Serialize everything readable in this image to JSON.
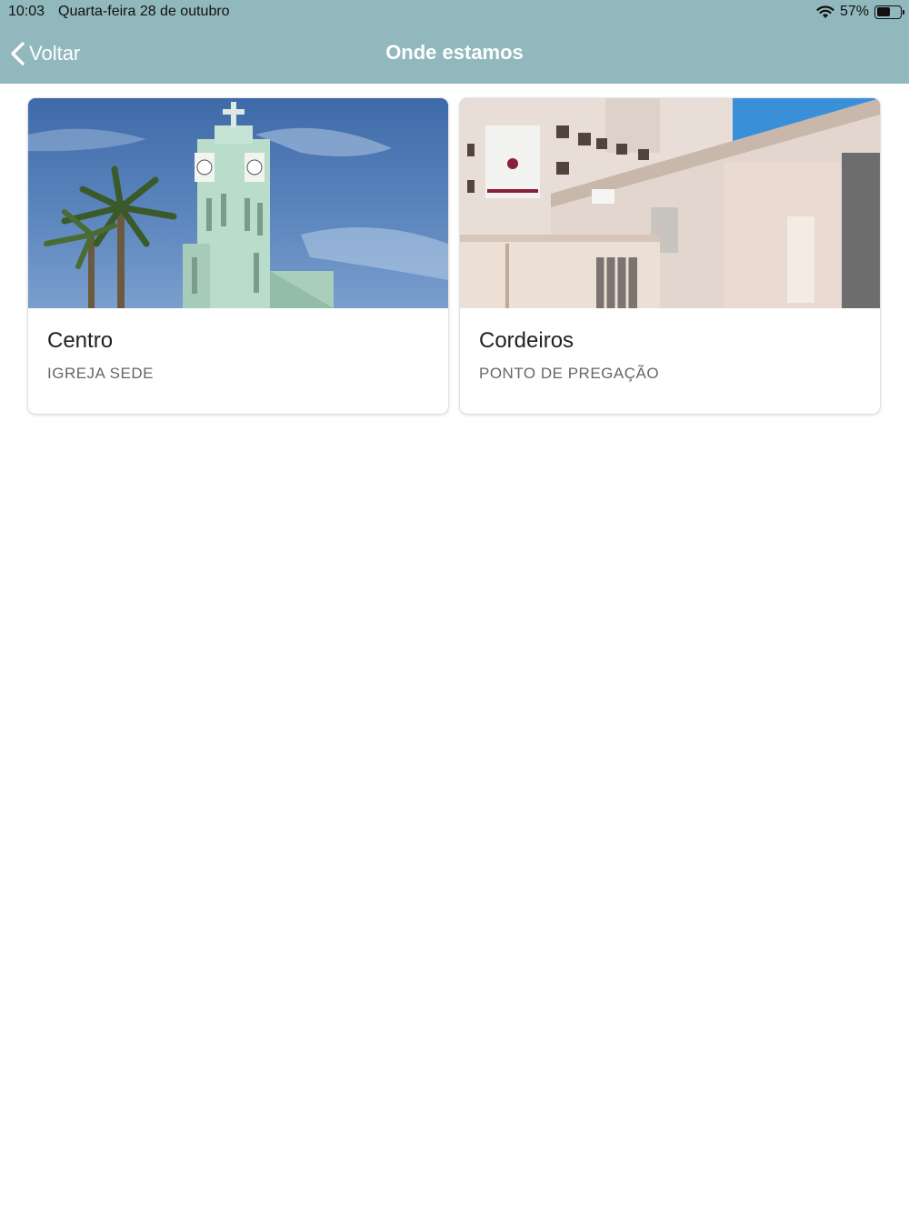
{
  "status_bar": {
    "time": "10:03",
    "date": "Quarta-feira 28 de outubro",
    "battery": "57%",
    "battery_level": 0.57,
    "icons": [
      "wifi-icon",
      "battery-icon"
    ]
  },
  "nav": {
    "back_label": "Voltar",
    "title": "Onde estamos",
    "color": "#91b8bd"
  },
  "cards": [
    {
      "title": "Centro",
      "subtitle": "IGREJA SEDE",
      "image": "church-tower-photo"
    },
    {
      "title": "Cordeiros",
      "subtitle": "PONTO DE PREGAÇÃO",
      "image": "building-photo"
    }
  ]
}
